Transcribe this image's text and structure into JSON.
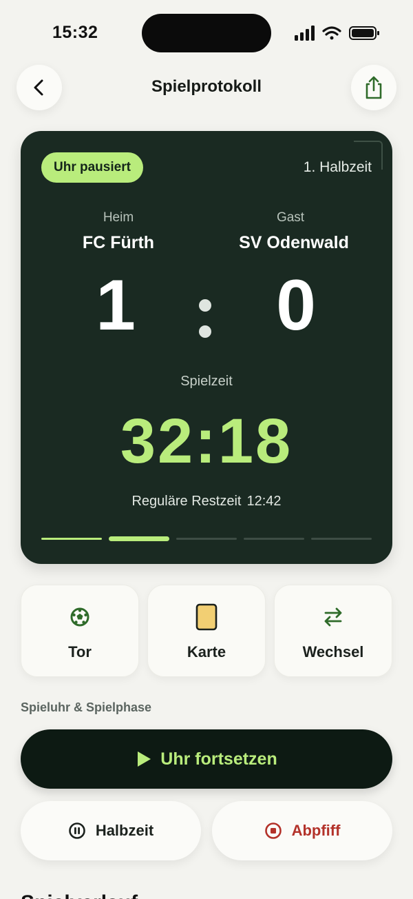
{
  "status_bar": {
    "time": "15:32"
  },
  "header": {
    "title": "Spielprotokoll"
  },
  "score_card": {
    "clock_status": "Uhr pausiert",
    "phase": "1. Halbzeit",
    "home": {
      "role": "Heim",
      "name": "FC Fürth",
      "score": "1"
    },
    "away": {
      "role": "Gast",
      "name": "SV Odenwald",
      "score": "0"
    },
    "playtime_label": "Spielzeit",
    "playtime": "32:18",
    "remaining_label": "Reguläre Restzeit",
    "remaining_time": "12:42",
    "progress_segments": [
      "done",
      "active",
      "pending",
      "pending",
      "pending"
    ]
  },
  "actions": [
    {
      "label": "Tor",
      "icon": "soccer-ball-icon"
    },
    {
      "label": "Karte",
      "icon": "yellow-card-icon"
    },
    {
      "label": "Wechsel",
      "icon": "swap-arrows-icon"
    }
  ],
  "controls": {
    "section_label": "Spieluhr & Spielphase",
    "resume_label": "Uhr fortsetzen",
    "halftime_label": "Halbzeit",
    "fulltime_label": "Abpfiff"
  },
  "next_section": {
    "heading": "Spielverlauf"
  },
  "colors": {
    "accent": "#b9ec7c",
    "card_bg": "#1a2a22",
    "danger": "#b3322a",
    "icon_green": "#2f6b2a",
    "card_yellow": "#f2cf73"
  }
}
